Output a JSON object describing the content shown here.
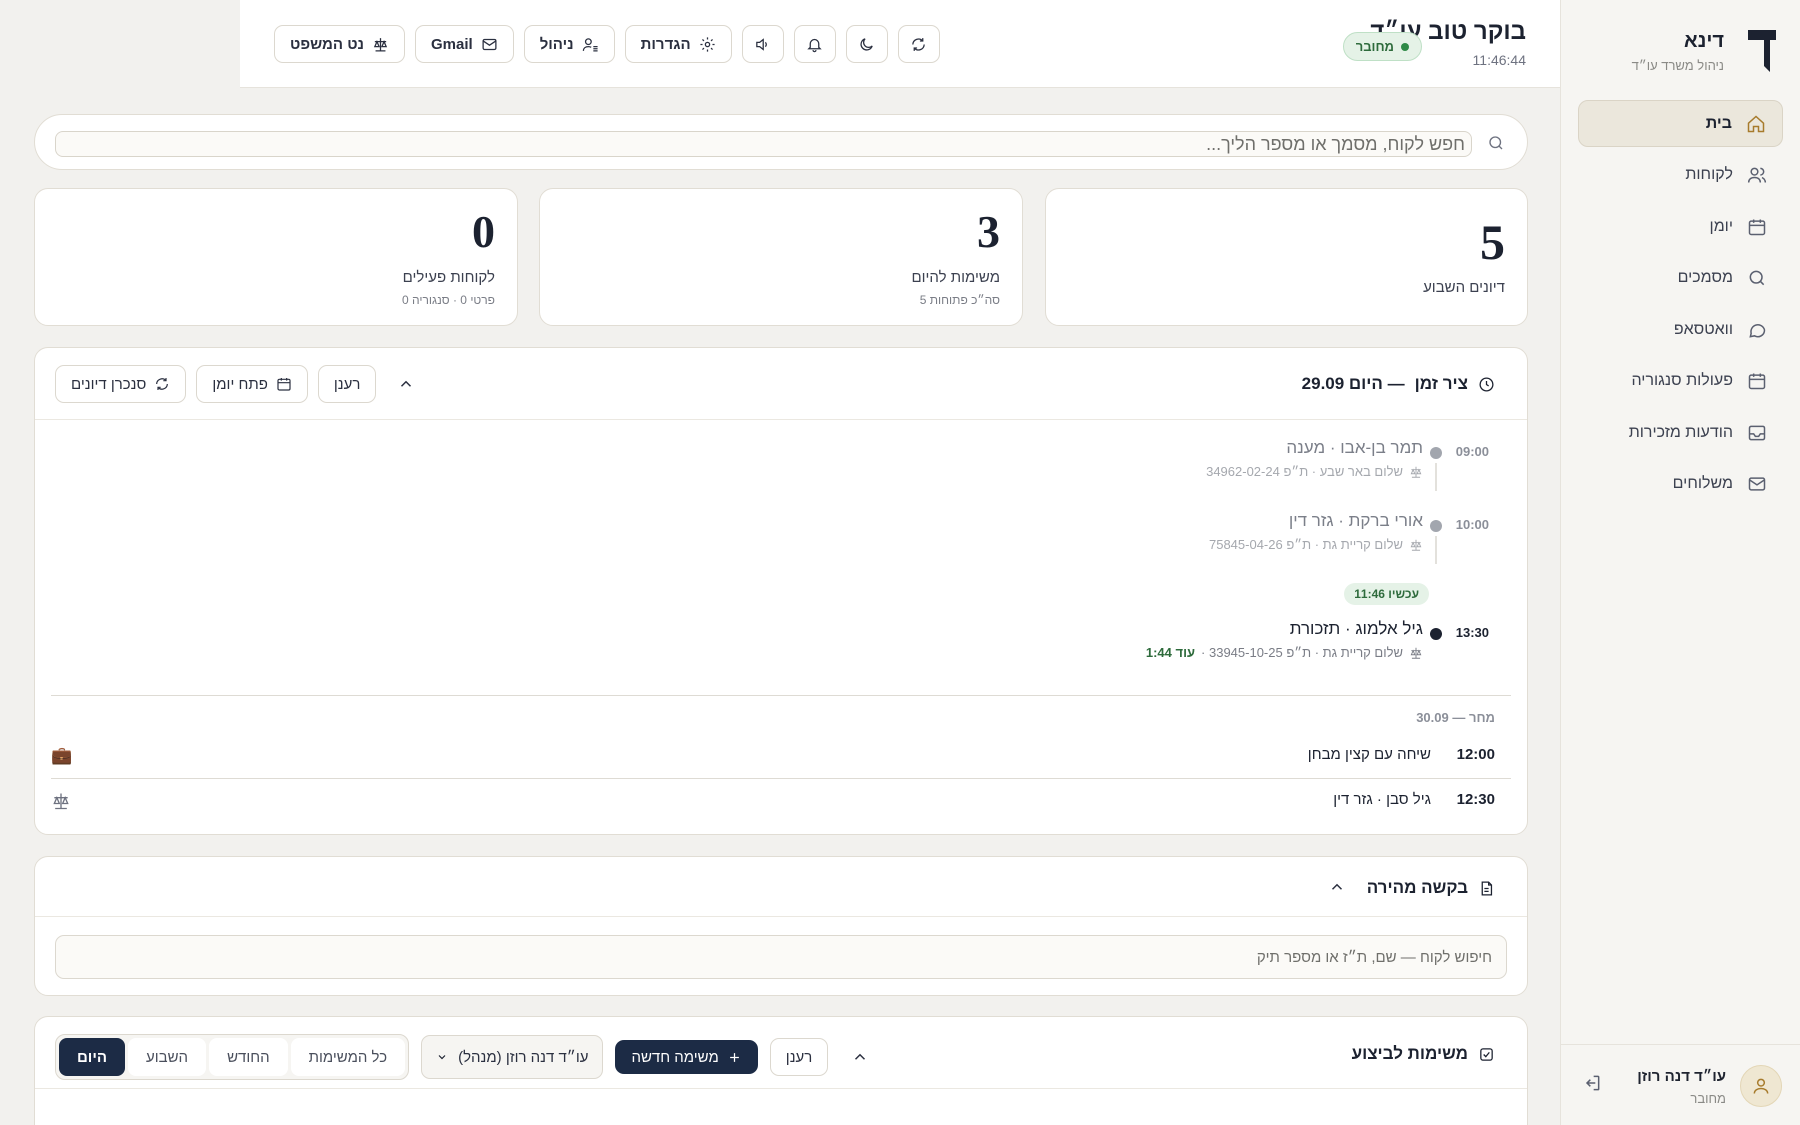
{
  "sidebar": {
    "brand_name": "דינא",
    "brand_sub": "ניהול משרד עו״ד",
    "items": [
      {
        "label": "בית",
        "icon": "home-icon"
      },
      {
        "label": "לקוחות",
        "icon": "users-icon"
      },
      {
        "label": "יומן",
        "icon": "calendar-icon"
      },
      {
        "label": "מסמכים",
        "icon": "search-icon"
      },
      {
        "label": "וואטסאפ",
        "icon": "chat-icon"
      },
      {
        "label": "פעולות סנגוריה",
        "icon": "calendar-icon"
      },
      {
        "label": "הודעות מזכירות",
        "icon": "inbox-icon"
      },
      {
        "label": "משלוחים",
        "icon": "mail-icon"
      }
    ],
    "user": {
      "name": "עו״ד דנה רוזן",
      "status": "מחובר"
    }
  },
  "topbar": {
    "greeting": "בוקר טוב עו״ד",
    "time": "11:46:44",
    "status": "מחובר",
    "buttons": {
      "netmishpat": "נט המשפט",
      "gmail": "Gmail",
      "manage": "ניהול",
      "settings": "הגדרות"
    }
  },
  "search": {
    "placeholder": "חפש לקוח, מסמך או מספר הליך..."
  },
  "stats": [
    {
      "value": "5",
      "label": "דיונים השבוע",
      "sub": ""
    },
    {
      "value": "3",
      "label": "משימות להיום",
      "sub": "סה״כ פתוחות 5"
    },
    {
      "value": "0",
      "label": "לקוחות פעילים",
      "sub": "פרטי 0 · סנגוריה 0"
    }
  ],
  "timeline": {
    "title": "ציר זמן",
    "title_suffix": "— היום 29.09",
    "buttons": {
      "sync": "סנכרן דיונים",
      "open": "פתח יומן",
      "refresh": "רענן"
    },
    "now_label": "עכשיו 11:46",
    "events": [
      {
        "time": "09:00",
        "name": "תמר בן-אבו · מענה",
        "meta": "שלום באר שבע · ת״פ 34962-02-24"
      },
      {
        "time": "10:00",
        "name": "אורי ברקת · גזר דין",
        "meta": "שלום קריית גת · ת״פ 75845-04-26"
      },
      {
        "time": "13:30",
        "name": "גיל אלמוג · תזכורת",
        "meta": "שלום קריית גת · ת״פ 33945-10-25 ·",
        "remaining": "עוד 1:44"
      }
    ],
    "tomorrow_label": "מחר — 30.09",
    "tomorrow": [
      {
        "time": "12:00",
        "name": "שיחה עם קצין מבחן",
        "icon": "briefcase-icon"
      },
      {
        "time": "12:30",
        "name": "גיל סבן · גזר דין",
        "icon": "scale-icon"
      }
    ]
  },
  "quick": {
    "title": "בקשה מהירה",
    "placeholder": "חיפוש לקוח — שם, ת״ז או מספר תיק"
  },
  "tasks": {
    "title": "משימות לביצוע",
    "tabs": [
      "היום",
      "השבוע",
      "החודש",
      "כל המשימות"
    ],
    "assignee": "עו״ד דנה רוזן (מנהל)",
    "new_label": "משימה חדשה",
    "refresh": "רענן"
  }
}
